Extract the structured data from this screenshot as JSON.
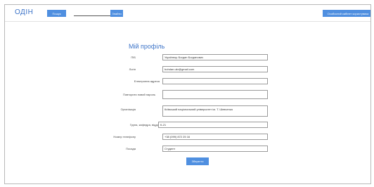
{
  "header": {
    "logo": "ОДІН",
    "search_button": "Пошук",
    "find_button": "Знайти",
    "cabinet_button": "Особистий кабінет користувача"
  },
  "profile": {
    "title": "Мій профіль",
    "fields": [
      {
        "label": "ПІБ",
        "value": "Українець Богдан Богданович"
      },
      {
        "label": "Логін",
        "value": "bohdan.ukr@gmail.com"
      },
      {
        "label": "Електронна адреса",
        "value": ""
      },
      {
        "label": "Повторити новий пароль",
        "value": ""
      },
      {
        "label": "Організація",
        "value": "Київський національний університет ім. Т. Шевченка"
      },
      {
        "label": "Група, кафедра, відділ",
        "value": "К-21"
      },
      {
        "label": "Номер телефону",
        "value": "+38 (099) 872 25 16"
      },
      {
        "label": "Посада",
        "value": "Студент"
      }
    ],
    "save_button": "Зберегти"
  },
  "colors": {
    "accent": "#4f8fe0",
    "title": "#3b73c8"
  }
}
